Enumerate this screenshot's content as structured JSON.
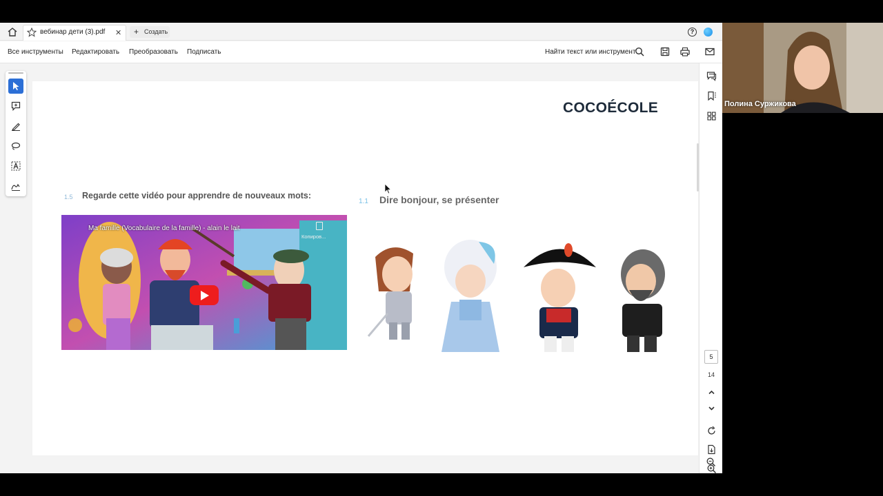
{
  "app": {
    "tab_title": "вебинар дети (3).pdf",
    "new_tab_label": "Создать",
    "menu": [
      "Все инструменты",
      "Редактировать",
      "Преобразовать",
      "Подписать"
    ],
    "find_label": "Найти текст или инструмент",
    "help_glyph": "?"
  },
  "document": {
    "brand": "COCOÉCOLE",
    "section_a": {
      "number": "1.5",
      "title": "Regarde cette vidéo pour apprendre de nouveaux mots:"
    },
    "section_b": {
      "number": "1.1",
      "title": "Dire bonjour, se présenter"
    },
    "video": {
      "title": "Ma famille (Vocabulaire de la famille) - alain le lait",
      "copy_label": "Копиров..."
    }
  },
  "navigation": {
    "current_page": "5",
    "total_pages": "14"
  },
  "webcam": {
    "participant_name": "Полина Суржикова"
  },
  "colors": {
    "accent": "#2c6fd6",
    "brand": "#1e2b3a",
    "youtube_red": "#ee1d1d"
  },
  "icons": {
    "left_tools": [
      "select-arrow-icon",
      "add-comment-icon",
      "highlight-pen-icon",
      "lasso-draw-icon",
      "text-select-icon",
      "signature-icon"
    ],
    "right_tools": [
      "comments-icon",
      "bookmarks-icon",
      "thumbnails-icon",
      "rotate-icon",
      "page-extract-icon",
      "zoom-in-icon",
      "zoom-out-icon"
    ]
  }
}
